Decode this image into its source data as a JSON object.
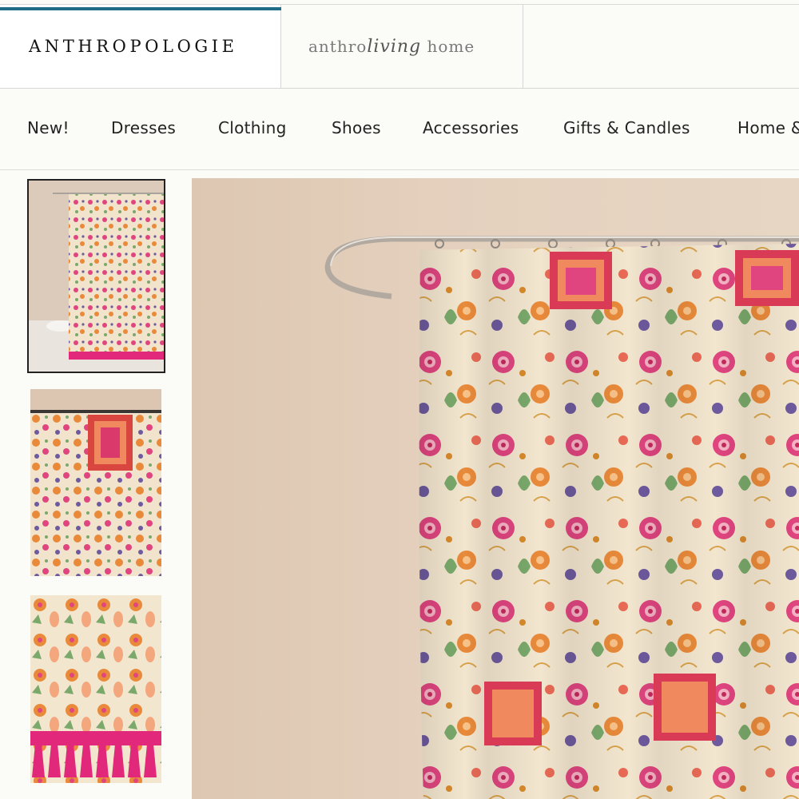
{
  "header": {
    "brand": "ANTHROPOLOGIE",
    "sub_brand": {
      "prefix": "anthro",
      "script": "living",
      "suffix": "home"
    },
    "accent_color": "#1f6c86"
  },
  "nav": {
    "items": [
      "New!",
      "Dresses",
      "Clothing",
      "Shoes",
      "Accessories",
      "Gifts & Candles",
      "Home &"
    ]
  },
  "gallery": {
    "thumbnails": [
      {
        "icon": "shower-curtain-full-view",
        "selected": true
      },
      {
        "icon": "shower-curtain-top-detail",
        "selected": false
      },
      {
        "icon": "shower-curtain-tassel-detail",
        "selected": false
      }
    ],
    "main_image": {
      "icon": "floral-elephant-shower-curtain"
    }
  },
  "colors": {
    "wall": "#e2cdb9",
    "curtain_base": "#f3e6cf",
    "pink": "#e0457f",
    "orange": "#e98a3a",
    "green": "#7aa96b",
    "purple": "#6e5a9e",
    "fringe": "#e2287a"
  }
}
